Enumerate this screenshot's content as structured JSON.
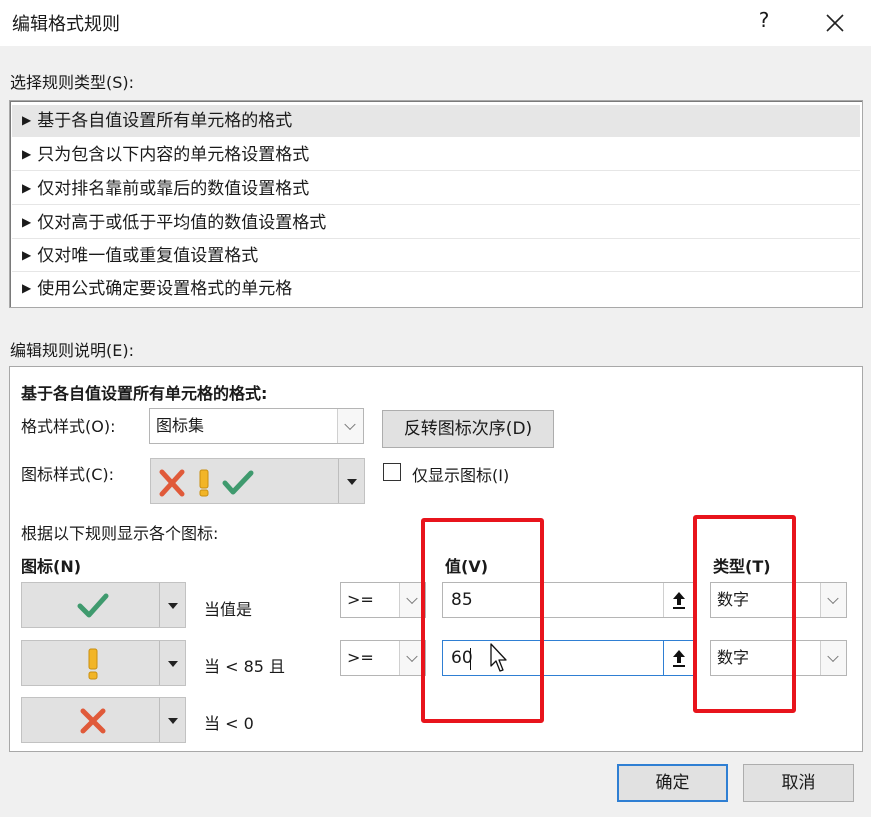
{
  "window": {
    "title": "编辑格式规则",
    "help": "?",
    "close_icon": "close-icon"
  },
  "rule_type": {
    "label": "选择规则类型(S):",
    "items": [
      "基于各自值设置所有单元格的格式",
      "只为包含以下内容的单元格设置格式",
      "仅对排名靠前或靠后的数值设置格式",
      "仅对高于或低于平均值的数值设置格式",
      "仅对唯一值或重复值设置格式",
      "使用公式确定要设置格式的单元格"
    ],
    "selected_index": 0,
    "bullet": "▶"
  },
  "rule_desc": {
    "label": "编辑规则说明(E):",
    "heading": "基于各自值设置所有单元格的格式:",
    "format_style_label": "格式样式(O):",
    "format_style_value": "图标集",
    "reverse_button": "反转图标次序(D)",
    "icon_style_label": "图标样式(C):",
    "show_icon_only_label": "仅显示图标(I)",
    "show_icon_only_checked": false,
    "rules_caption": "根据以下规则显示各个图标:",
    "icon_col_header": "图标(N)",
    "value_col_header": "值(V)",
    "type_col_header": "类型(T)",
    "rows": [
      {
        "icon": "green-check-icon",
        "condition": "当值是",
        "operator": ">=",
        "value": "85",
        "type": "数字"
      },
      {
        "icon": "yellow-exclamation-icon",
        "condition": "当 < 85 且",
        "operator": ">=",
        "value": "60",
        "type": "数字"
      },
      {
        "icon": "red-x-icon",
        "condition": "当 < 0"
      }
    ]
  },
  "footer": {
    "ok": "确定",
    "cancel": "取消"
  },
  "colors": {
    "highlight_frame": "#e8141c",
    "check_green": "#3f9a6e",
    "warn_yellow": "#f2b527",
    "x_red": "#e05a3a",
    "focus_blue": "#2f7fd3"
  }
}
